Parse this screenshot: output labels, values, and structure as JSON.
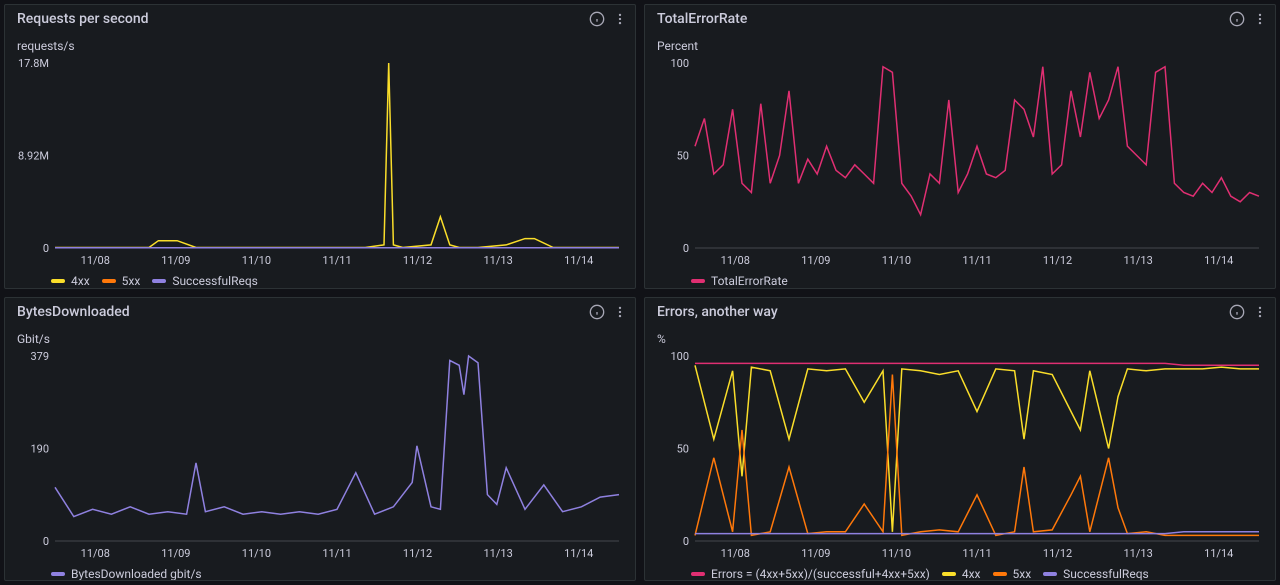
{
  "panels": [
    {
      "title": "Requests per second",
      "ylabel": "requests/s",
      "legend": [
        {
          "label": "4xx",
          "color": "#FADE2A"
        },
        {
          "label": "5xx",
          "color": "#FF780A"
        },
        {
          "label": "SuccessfulReqs",
          "color": "#8F81E0"
        }
      ]
    },
    {
      "title": "TotalErrorRate",
      "ylabel": "Percent",
      "legend": [
        {
          "label": "TotalErrorRate",
          "color": "#E02F72"
        }
      ]
    },
    {
      "title": "BytesDownloaded",
      "ylabel": "Gbit/s",
      "legend": [
        {
          "label": "BytesDownloaded gbit/s",
          "color": "#8F81E0"
        }
      ]
    },
    {
      "title": "Errors, another way",
      "ylabel": "%",
      "legend": [
        {
          "label": "Errors = (4xx+5xx)/(successful+4xx+5xx)",
          "color": "#E02F72"
        },
        {
          "label": "4xx",
          "color": "#FADE2A"
        },
        {
          "label": "5xx",
          "color": "#FF780A"
        },
        {
          "label": "SuccessfulReqs",
          "color": "#8F81E0"
        }
      ]
    }
  ],
  "chart_data": [
    {
      "type": "line",
      "title": "Requests per second",
      "xlabel": "",
      "ylabel": "requests/s",
      "ylim": [
        0,
        17.8
      ],
      "y_ticks": [
        0,
        8.92,
        17.8
      ],
      "y_tick_labels": [
        "0",
        "8.92M",
        "17.8M"
      ],
      "x_tick_labels": [
        "11/08",
        "11/09",
        "11/10",
        "11/11",
        "11/12",
        "11/13",
        "11/14"
      ],
      "x": [
        0,
        0.5,
        1,
        1.1,
        1.3,
        1.5,
        2,
        2.5,
        3,
        3.3,
        3.5,
        3.55,
        3.6,
        3.7,
        4,
        4.1,
        4.2,
        4.3,
        4.5,
        4.8,
        5,
        5.1,
        5.3,
        5.5,
        6
      ],
      "series": [
        {
          "name": "4xx",
          "color": "#FADE2A",
          "values": [
            0.05,
            0.05,
            0.05,
            0.7,
            0.7,
            0.05,
            0.05,
            0.05,
            0.05,
            0.05,
            0.3,
            17.8,
            0.3,
            0.05,
            0.3,
            3.0,
            0.3,
            0.05,
            0.05,
            0.3,
            0.9,
            0.9,
            0.05,
            0.05,
            0.05
          ]
        },
        {
          "name": "5xx",
          "color": "#FF780A",
          "values": [
            0.02,
            0.02,
            0.02,
            0.02,
            0.02,
            0.02,
            0.02,
            0.02,
            0.02,
            0.02,
            0.02,
            0.02,
            0.02,
            0.02,
            0.02,
            0.02,
            0.02,
            0.02,
            0.02,
            0.02,
            0.02,
            0.02,
            0.02,
            0.02,
            0.02
          ]
        },
        {
          "name": "SuccessfulReqs",
          "color": "#8F81E0",
          "values": [
            0.03,
            0.03,
            0.03,
            0.03,
            0.03,
            0.03,
            0.03,
            0.03,
            0.03,
            0.03,
            0.03,
            0.03,
            0.03,
            0.03,
            0.03,
            0.03,
            0.03,
            0.03,
            0.03,
            0.03,
            0.03,
            0.03,
            0.03,
            0.03,
            0.03
          ]
        }
      ]
    },
    {
      "type": "line",
      "title": "TotalErrorRate",
      "xlabel": "",
      "ylabel": "Percent",
      "ylim": [
        0,
        100
      ],
      "y_ticks": [
        0,
        50,
        100
      ],
      "y_tick_labels": [
        "0",
        "50",
        "100"
      ],
      "x_tick_labels": [
        "11/08",
        "11/09",
        "11/10",
        "11/11",
        "11/12",
        "11/13",
        "11/14"
      ],
      "x": [
        0,
        0.1,
        0.2,
        0.3,
        0.4,
        0.5,
        0.6,
        0.7,
        0.8,
        0.9,
        1,
        1.1,
        1.2,
        1.3,
        1.4,
        1.5,
        1.6,
        1.7,
        1.8,
        1.9,
        2,
        2.1,
        2.2,
        2.3,
        2.4,
        2.5,
        2.6,
        2.7,
        2.8,
        2.9,
        3,
        3.1,
        3.2,
        3.3,
        3.4,
        3.5,
        3.6,
        3.7,
        3.8,
        3.9,
        4,
        4.1,
        4.2,
        4.3,
        4.4,
        4.5,
        4.6,
        4.7,
        4.8,
        4.9,
        5,
        5.1,
        5.2,
        5.3,
        5.4,
        5.5,
        5.6,
        5.7,
        5.8,
        5.9,
        6
      ],
      "series": [
        {
          "name": "TotalErrorRate",
          "color": "#E02F72",
          "values": [
            55,
            70,
            40,
            45,
            75,
            35,
            30,
            78,
            35,
            50,
            85,
            35,
            48,
            40,
            55,
            42,
            38,
            45,
            40,
            35,
            98,
            95,
            35,
            28,
            18,
            40,
            35,
            80,
            30,
            40,
            55,
            40,
            38,
            42,
            80,
            75,
            60,
            98,
            40,
            45,
            85,
            60,
            95,
            70,
            80,
            98,
            55,
            50,
            45,
            95,
            98,
            35,
            30,
            28,
            35,
            30,
            38,
            28,
            25,
            30,
            28
          ]
        }
      ]
    },
    {
      "type": "line",
      "title": "BytesDownloaded",
      "xlabel": "",
      "ylabel": "Gbit/s",
      "ylim": [
        0,
        379
      ],
      "y_ticks": [
        0,
        190,
        379
      ],
      "y_tick_labels": [
        "0",
        "190",
        "379"
      ],
      "x_tick_labels": [
        "11/08",
        "11/09",
        "11/10",
        "11/11",
        "11/12",
        "11/13",
        "11/14"
      ],
      "x": [
        0,
        0.2,
        0.4,
        0.6,
        0.8,
        1,
        1.2,
        1.4,
        1.5,
        1.6,
        1.8,
        2,
        2.2,
        2.4,
        2.6,
        2.8,
        3,
        3.2,
        3.4,
        3.6,
        3.8,
        3.85,
        4,
        4.1,
        4.2,
        4.3,
        4.35,
        4.4,
        4.5,
        4.6,
        4.7,
        4.8,
        5,
        5.2,
        5.4,
        5.6,
        5.8,
        6
      ],
      "series": [
        {
          "name": "BytesDownloaded gbit/s",
          "color": "#8F81E0",
          "values": [
            110,
            50,
            65,
            55,
            70,
            55,
            60,
            55,
            160,
            60,
            70,
            55,
            60,
            55,
            60,
            55,
            65,
            140,
            55,
            70,
            120,
            195,
            70,
            65,
            370,
            360,
            300,
            379,
            365,
            95,
            75,
            150,
            65,
            115,
            60,
            70,
            90,
            95
          ]
        }
      ]
    },
    {
      "type": "line",
      "title": "Errors, another way",
      "xlabel": "",
      "ylabel": "%",
      "ylim": [
        0,
        100
      ],
      "y_ticks": [
        0,
        50,
        100
      ],
      "y_tick_labels": [
        "0",
        "50",
        "100"
      ],
      "x_tick_labels": [
        "11/08",
        "11/09",
        "11/10",
        "11/11",
        "11/12",
        "11/13",
        "11/14"
      ],
      "x": [
        0,
        0.2,
        0.4,
        0.5,
        0.6,
        0.8,
        1,
        1.2,
        1.4,
        1.6,
        1.8,
        2,
        2.1,
        2.2,
        2.4,
        2.6,
        2.8,
        3,
        3.2,
        3.4,
        3.5,
        3.6,
        3.8,
        4,
        4.1,
        4.2,
        4.4,
        4.5,
        4.6,
        4.8,
        5,
        5.2,
        5.4,
        5.6,
        5.8,
        6
      ],
      "series": [
        {
          "name": "Errors = (4xx+5xx)/(successful+4xx+5xx)",
          "color": "#E02F72",
          "values": [
            96,
            96,
            96,
            96,
            96,
            96,
            96,
            96,
            96,
            96,
            96,
            96,
            96,
            96,
            96,
            96,
            96,
            96,
            96,
            96,
            96,
            96,
            96,
            96,
            96,
            96,
            96,
            96,
            96,
            96,
            96,
            95,
            95,
            95,
            95,
            95
          ]
        },
        {
          "name": "4xx",
          "color": "#FADE2A",
          "values": [
            95,
            55,
            92,
            35,
            94,
            92,
            55,
            93,
            92,
            93,
            75,
            92,
            5,
            93,
            92,
            90,
            92,
            70,
            93,
            92,
            55,
            92,
            90,
            70,
            60,
            92,
            50,
            78,
            93,
            92,
            93,
            93,
            93,
            94,
            93,
            93
          ]
        },
        {
          "name": "5xx",
          "color": "#FF780A",
          "values": [
            3,
            45,
            5,
            60,
            3,
            5,
            40,
            4,
            5,
            5,
            20,
            5,
            90,
            3,
            5,
            6,
            5,
            25,
            3,
            5,
            40,
            5,
            6,
            25,
            35,
            5,
            45,
            18,
            4,
            5,
            3,
            3,
            3,
            3,
            3,
            3
          ]
        },
        {
          "name": "SuccessfulReqs",
          "color": "#8F81E0",
          "values": [
            4,
            4,
            4,
            4,
            4,
            4,
            4,
            4,
            4,
            4,
            4,
            4,
            4,
            4,
            4,
            4,
            4,
            4,
            4,
            4,
            4,
            4,
            4,
            4,
            4,
            4,
            4,
            4,
            4,
            4,
            4,
            5,
            5,
            5,
            5,
            5
          ]
        }
      ]
    }
  ]
}
